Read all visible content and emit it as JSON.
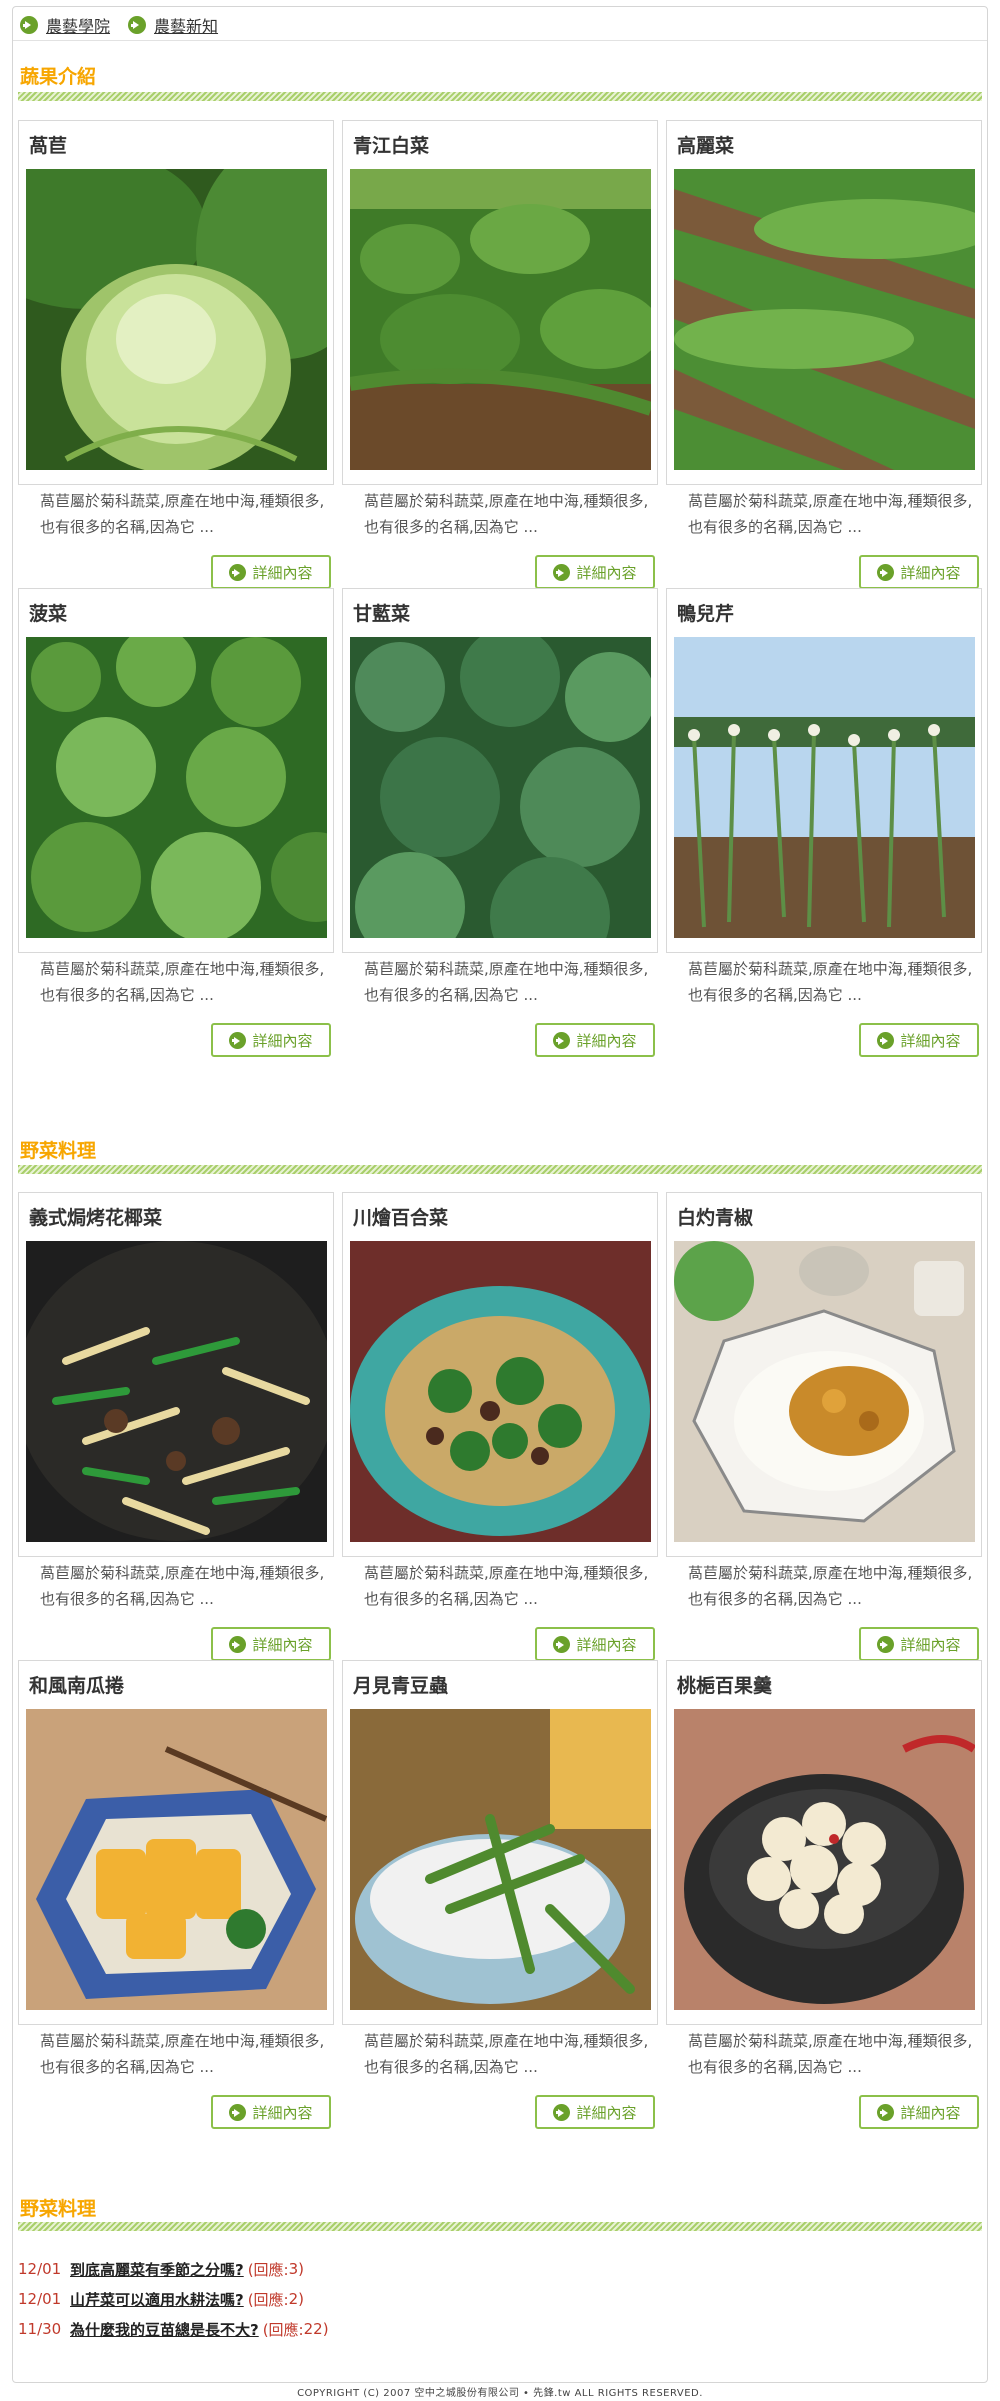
{
  "nav": {
    "items": [
      {
        "label": "農藝學院"
      },
      {
        "label": "農藝新知"
      }
    ]
  },
  "sections": [
    {
      "title": "蔬果介紹"
    },
    {
      "title": "野菜料理"
    },
    {
      "title": "野菜料理"
    }
  ],
  "detail_label": "詳細內容",
  "desc": "萵苣屬於菊科蔬菜,原產在地中海,種類很多,也有很多的名稱,因為它 ...",
  "cards_veg": [
    {
      "title": "萵苣",
      "photo": "cabbage-photo"
    },
    {
      "title": "青江白菜",
      "photo": "field-photo"
    },
    {
      "title": "高麗菜",
      "photo": "rows-photo"
    },
    {
      "title": "菠菜",
      "photo": "greens-photo"
    },
    {
      "title": "甘藍菜",
      "photo": "kale-photo"
    },
    {
      "title": "鴨兒芹",
      "photo": "scallion-photo"
    }
  ],
  "cards_food": [
    {
      "title": "義式焗烤花椰菜",
      "photo": "stirfry-photo"
    },
    {
      "title": "川燴百合菜",
      "photo": "broccoli-plate-photo"
    },
    {
      "title": "白灼青椒",
      "photo": "curry-photo"
    },
    {
      "title": "和風南瓜捲",
      "photo": "pumpkin-photo"
    },
    {
      "title": "月見青豆蟲",
      "photo": "edamame-photo"
    },
    {
      "title": "桃梔百果羹",
      "photo": "radish-pot-photo"
    }
  ],
  "news": [
    {
      "date": "12/01",
      "title": "到底高麗菜有季節之分嗎?",
      "reply_label": "(回應:",
      "count": "3",
      "close": ")"
    },
    {
      "date": "12/01",
      "title": "山芹菜可以適用水耕法嗎?",
      "reply_label": "(回應:",
      "count": "2",
      "close": ")"
    },
    {
      "date": "11/30",
      "title": "為什麼我的豆苗總是長不大?",
      "reply_label": "(回應:",
      "count": "22",
      "close": ")"
    }
  ],
  "footer": "COPYRIGHT (C) 2007 空中之城股份有限公司 • 先鋒.tw ALL RIGHTS RESERVED.",
  "colors": {
    "accent": "#f7a600",
    "green": "#6aa12a",
    "red": "#c0392b"
  }
}
